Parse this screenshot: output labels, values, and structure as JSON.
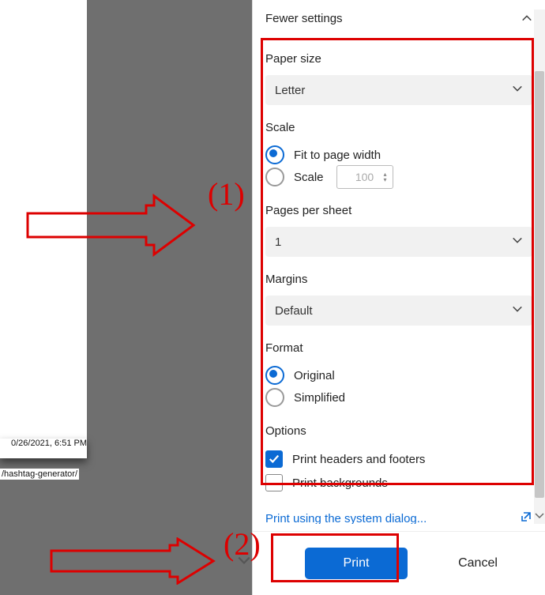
{
  "preview": {
    "timestamp": "0/26/2021, 6:51 PM",
    "url": "/hashtag-generator/"
  },
  "header": {
    "title": "Fewer settings"
  },
  "paper_size": {
    "label": "Paper size",
    "value": "Letter"
  },
  "scale": {
    "label": "Scale",
    "fit_label": "Fit to page width",
    "scale_label": "Scale",
    "scale_value": "100",
    "selected": "fit"
  },
  "pages_per_sheet": {
    "label": "Pages per sheet",
    "value": "1"
  },
  "margins": {
    "label": "Margins",
    "value": "Default"
  },
  "format": {
    "label": "Format",
    "original_label": "Original",
    "simplified_label": "Simplified",
    "selected": "original"
  },
  "options": {
    "label": "Options",
    "headers_footers_label": "Print headers and footers",
    "headers_footers_checked": true,
    "backgrounds_label": "Print backgrounds",
    "backgrounds_checked": false
  },
  "system_dialog_link": "Print using the system dialog...",
  "footer": {
    "print_label": "Print",
    "cancel_label": "Cancel"
  },
  "annotations": {
    "num1": "(1)",
    "num2": "(2)"
  }
}
